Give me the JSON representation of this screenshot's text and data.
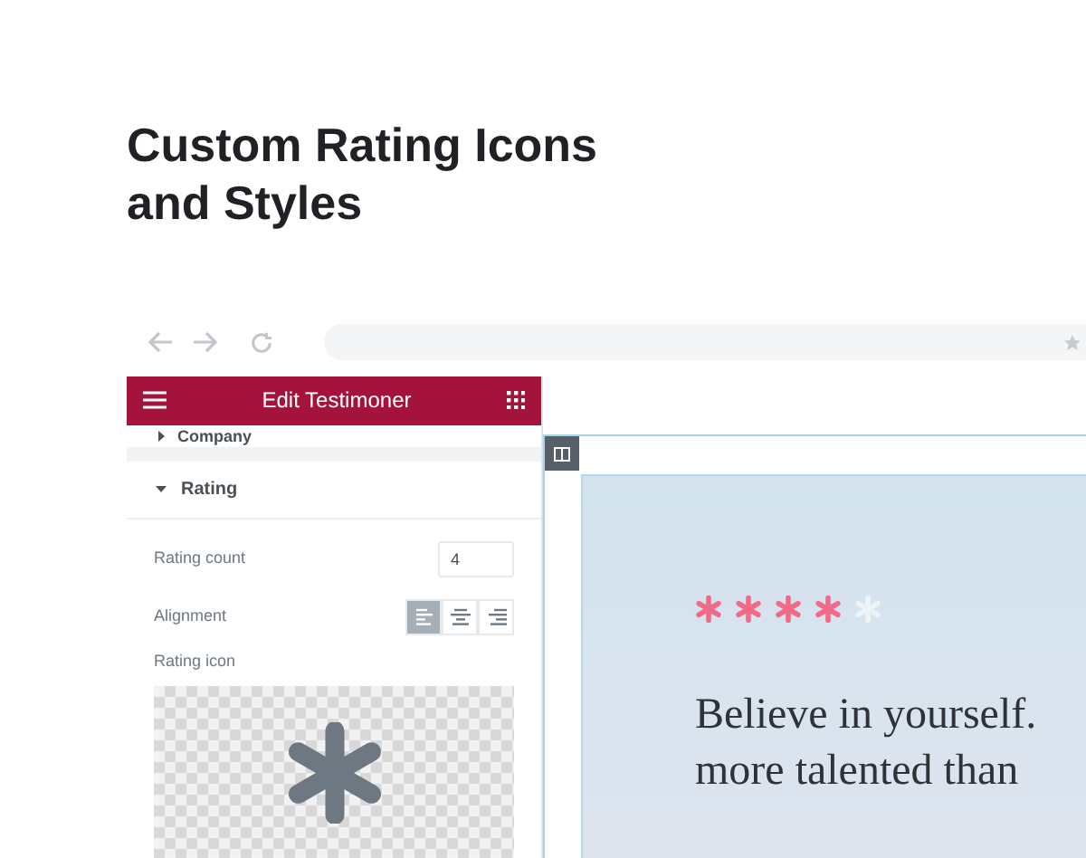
{
  "heading": [
    "Custom Rating Icons",
    "and Styles"
  ],
  "panel": {
    "title": "Edit Testimoner",
    "collapsed_section": {
      "label": "Company",
      "expanded": false
    },
    "section": {
      "label": "Rating",
      "expanded": true
    },
    "rating_count": {
      "label": "Rating count",
      "value": "4"
    },
    "alignment": {
      "label": "Alignment",
      "options": [
        {
          "kind": "left",
          "selected": true
        },
        {
          "kind": "center",
          "selected": false
        },
        {
          "kind": "right",
          "selected": false
        }
      ]
    },
    "rating_icon": {
      "label": "Rating icon"
    }
  },
  "preview": {
    "rating_icons": [
      {
        "filled": true
      },
      {
        "filled": true
      },
      {
        "filled": true
      },
      {
        "filled": true
      },
      {
        "filled": false
      }
    ],
    "quote_lines": [
      "Believe in yourself.",
      "more talented than"
    ]
  }
}
